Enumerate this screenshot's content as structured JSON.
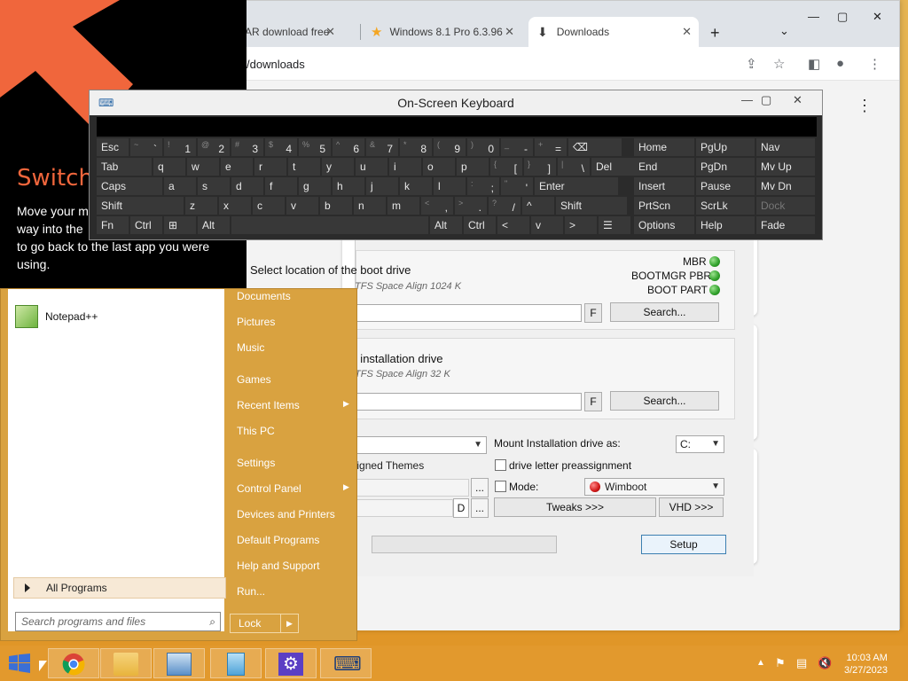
{
  "browser": {
    "tabs": [
      {
        "label": "AR download free"
      },
      {
        "label": "Windows 8.1 Pro 6.3.96"
      },
      {
        "label": "Downloads"
      }
    ],
    "new_tab": "+",
    "tab_search": "⌄",
    "window_controls": {
      "minimize": "—",
      "maximize": "▢",
      "close": "✕"
    },
    "address": "/downloads",
    "page_menu": "⋮"
  },
  "osk": {
    "title": "On-Screen Keyboard",
    "window_controls": {
      "minimize": "—",
      "maximize": "▢",
      "close": "✕"
    },
    "rows": [
      [
        "Esc",
        "~ `",
        "! 1",
        "@ 2",
        "# 3",
        "$ 4",
        "% 5",
        "^ 6",
        "& 7",
        "* 8",
        "( 9",
        ") 0",
        "_ -",
        "+ =",
        "⌫"
      ],
      [
        "Tab",
        "q",
        "w",
        "e",
        "r",
        "t",
        "y",
        "u",
        "i",
        "o",
        "p",
        "{ [",
        "} ]",
        "| \\",
        "Del"
      ],
      [
        "Caps",
        "a",
        "s",
        "d",
        "f",
        "g",
        "h",
        "j",
        "k",
        "l",
        ": ;",
        "\" '",
        "Enter"
      ],
      [
        "Shift",
        "z",
        "x",
        "c",
        "v",
        "b",
        "n",
        "m",
        "< ,",
        "> .",
        "? /",
        "^",
        "Shift"
      ],
      [
        "Fn",
        "Ctrl",
        "⊞",
        "Alt",
        "",
        "Alt",
        "Ctrl",
        "<",
        "v",
        ">",
        "☰"
      ]
    ],
    "nav": [
      [
        "Home",
        "PgUp",
        "Nav"
      ],
      [
        "End",
        "PgDn",
        "Mv Up"
      ],
      [
        "Insert",
        "Pause",
        "Mv Dn"
      ],
      [
        "PrtScn",
        "ScrLk",
        "Dock"
      ],
      [
        "Options",
        "Help",
        "Fade"
      ]
    ]
  },
  "setup": {
    "boot_title": "Select location of the boot drive",
    "boot_sub": "TFS Space Align 1024 K",
    "mbr": "MBR",
    "bootmgr_pbr": "BOOTMGR PBR",
    "boot_part": "BOOT PART",
    "f_label": "F",
    "search_label": "Search...",
    "install_title": "Select location of the installation drive",
    "install_sub": "TFS Space Align 32 K",
    "mount_label": "Mount Installation drive as:",
    "mount_value": "C:",
    "themes_label": "Allow installation unsigned Themes",
    "drive_letter_label": "drive letter preassignment",
    "mode_label": "Mode:",
    "mode_value": "Wimboot",
    "ellipsis": "...",
    "d_label": "D",
    "tweaks": "Tweaks >>>",
    "vhd": "VHD >>>",
    "setup_btn": "Setup"
  },
  "switch_overlay": {
    "title": "Switch",
    "body": "Move your m... way into the... to go back to the last app you were using.",
    "line1": "Move your m",
    "line2": "way into the",
    "line3": "to go back to the last app you were",
    "line4": "using."
  },
  "start": {
    "programs": [
      {
        "label": "Notepad++"
      }
    ],
    "all_programs": "All Programs",
    "search_placeholder": "Search programs and files",
    "right_items": [
      {
        "label": "Documents"
      },
      {
        "label": "Pictures"
      },
      {
        "label": "Music"
      },
      {
        "label": "Games"
      },
      {
        "label": "Recent Items"
      },
      {
        "label": "This PC"
      },
      {
        "label": "Settings"
      },
      {
        "label": "Control Panel"
      },
      {
        "label": "Devices and Printers"
      },
      {
        "label": "Default Programs"
      },
      {
        "label": "Help and Support"
      },
      {
        "label": "Run..."
      }
    ],
    "lock": "Lock"
  },
  "taskbar": {
    "time": "10:03 AM",
    "date": "3/27/2023",
    "apps": [
      "start-icon",
      "chrome-icon",
      "file-explorer-icon",
      "remote-desktop-icon",
      "notepad-icon",
      "settings-icon",
      "on-screen-keyboard-icon"
    ]
  },
  "colors": {
    "accent": "#e3a52f",
    "switch_title": "#f0663c",
    "osk_bg": "#2b2b2b",
    "led_green": "#2fa02a",
    "led_red": "#d01818"
  }
}
